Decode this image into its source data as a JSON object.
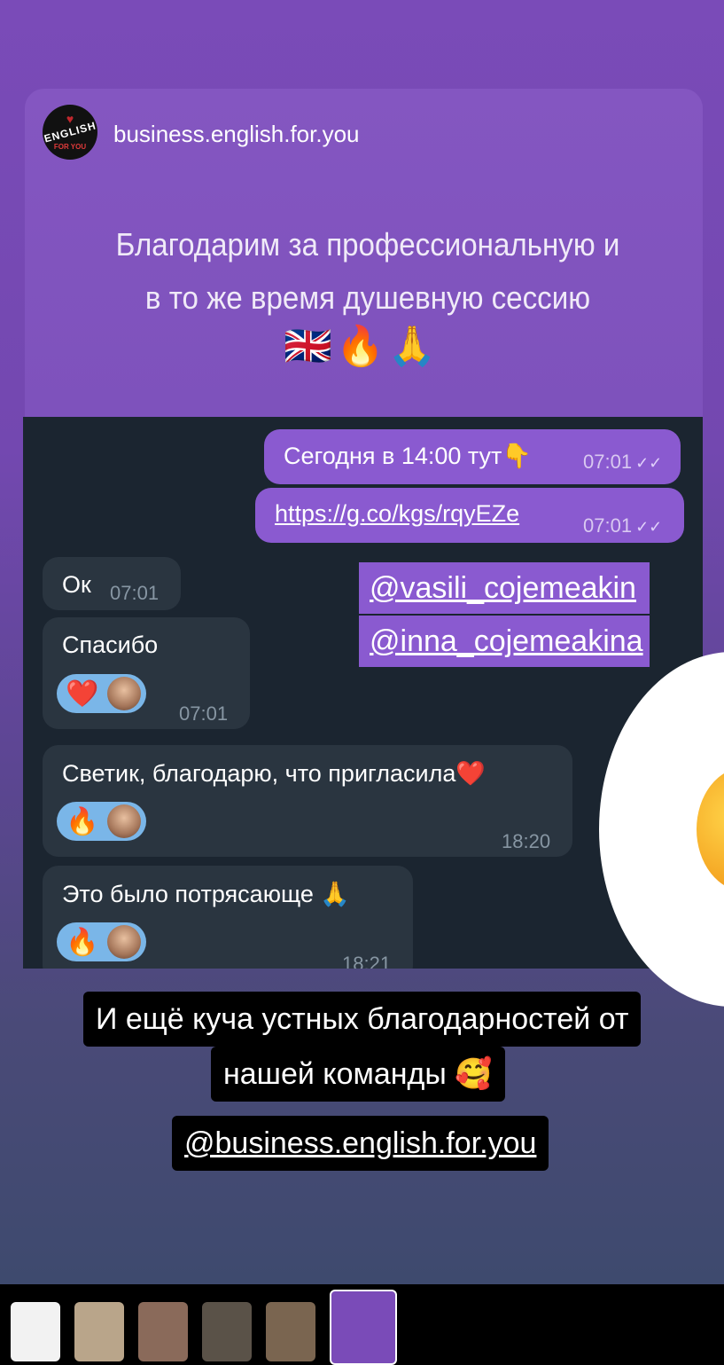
{
  "post": {
    "username": "business.english.for.you",
    "avatar_text": "ENGLISH",
    "avatar_subtext": "FOR YOU",
    "caption_line1": "Благодарим за профессиональную и",
    "caption_line2": "в то же время душевную сессию",
    "caption_emojis": "🇬🇧🔥🙏"
  },
  "chat": {
    "messages": [
      {
        "text": "Сегодня в 14:00 тут👇",
        "time": "07:01",
        "checks": "✓✓"
      },
      {
        "text": "https://g.co/kgs/rqyEZe",
        "time": "07:01",
        "checks": "✓✓"
      },
      {
        "text": "Ок",
        "time": "07:01"
      },
      {
        "text": "Спасибо",
        "time": "07:01",
        "reaction": "❤️"
      },
      {
        "text": "Светик, благодарю, что пригласила❤️",
        "time": "18:20",
        "reaction": "🔥"
      },
      {
        "text": "Это было потрясающе 🙏",
        "time": "18:21",
        "reaction": "🔥"
      }
    ],
    "mentions": [
      "@vasili_cojemeakin",
      "@inna_cojemeakina"
    ]
  },
  "story": {
    "note_line1": "И ещё куча устных благодарностей от",
    "note_line2": "нашей команды 🥰",
    "mention": "@business.english.for.you"
  },
  "colors": {
    "accent": "#8a5ad0",
    "chat_bg": "#1b2530",
    "incoming": "#2a3540",
    "reaction": "#7ab6e8"
  }
}
